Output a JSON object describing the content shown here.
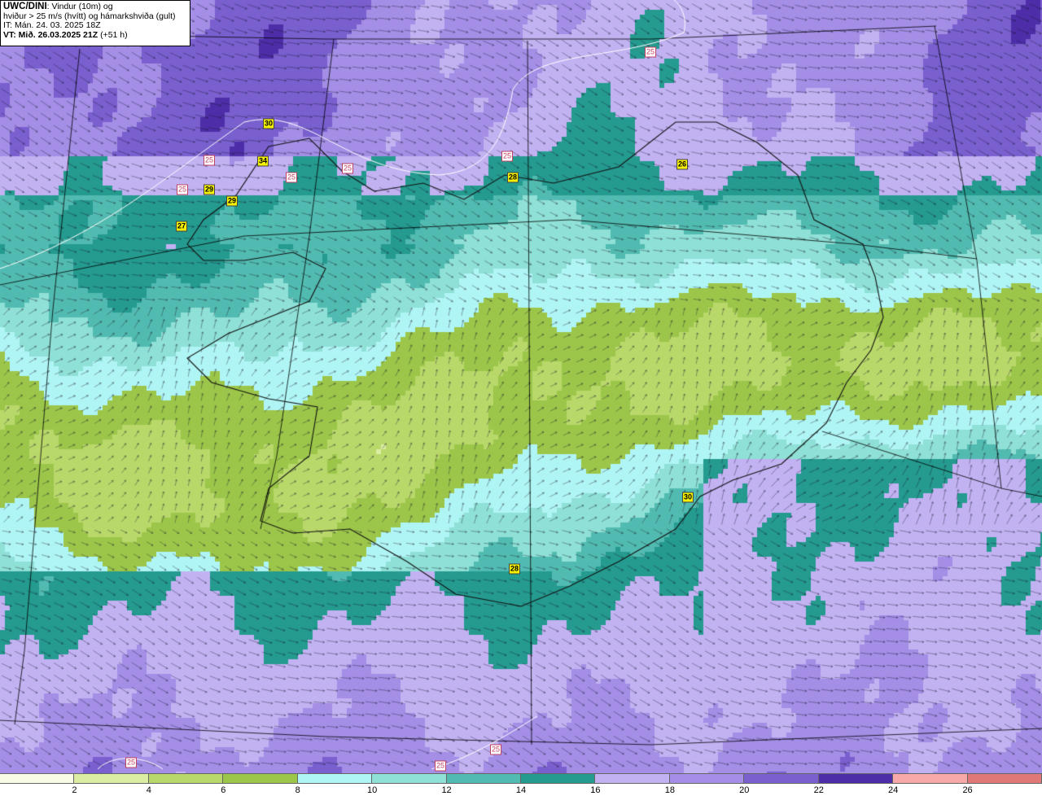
{
  "header": {
    "title": "UWC/DINI",
    "title_rest": ": Vindur (10m) og",
    "line2": "hviður > 25 m/s (hvítt) og hámarkshviða (gult)",
    "line3": "IT: Mán. 24. 03. 2025 18Z",
    "line4_bold": "VT: Mið. 26.03.2025 21Z",
    "line4_rest": " (+51 h)"
  },
  "legend": {
    "ticks": [
      "2",
      "4",
      "6",
      "8",
      "10",
      "12",
      "14",
      "16",
      "18",
      "20",
      "22",
      "24",
      "26"
    ],
    "colors": [
      "#fafbe6",
      "#dbeda2",
      "#b9d86a",
      "#9cc64a",
      "#b0f5f5",
      "#8fe0d6",
      "#52bbb1",
      "#259a8f",
      "#c2b2f2",
      "#a48ee6",
      "#7a5fcf",
      "#4d2ea8",
      "#f7a8a8",
      "#e07878"
    ]
  },
  "markers": {
    "gust_threshold_labels": [
      "25",
      "25",
      "25",
      "25",
      "25",
      "25",
      "25",
      "25",
      "25",
      "25"
    ],
    "max_gust_labels": [
      "30",
      "34",
      "29",
      "29",
      "27",
      "28",
      "26",
      "30",
      "28"
    ]
  },
  "palette": {
    "land_outline": "#111111",
    "graticule": "#000000",
    "gust_contour": "#ffffff"
  }
}
